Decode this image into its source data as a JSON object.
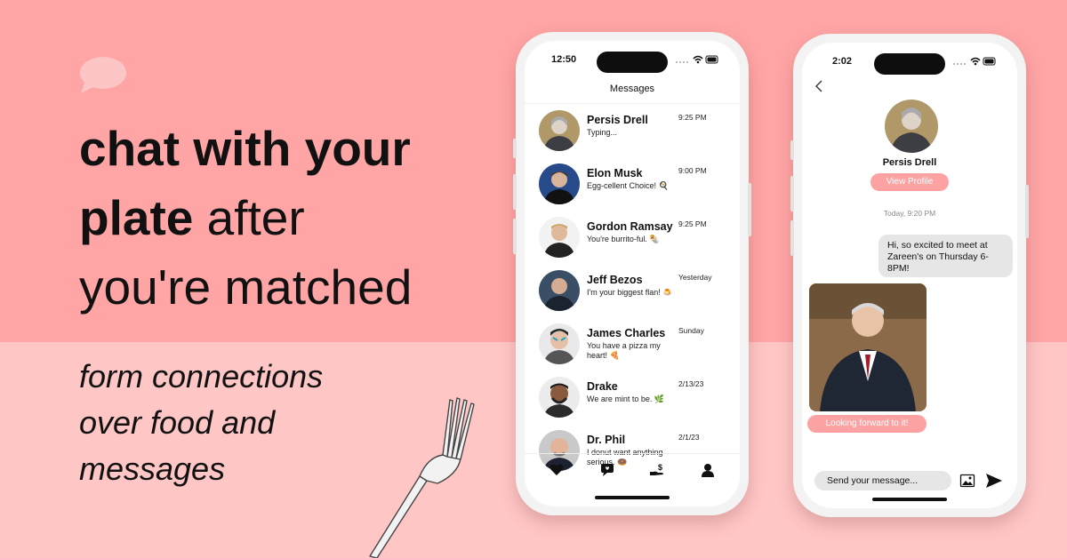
{
  "colors": {
    "accent": "#fca2a2",
    "bg_top": "#ffa5a5",
    "bg_bottom": "#ffc6c6"
  },
  "headline": {
    "line1_bold": "chat with your",
    "line2_bold": "plate",
    "line2_light": " after",
    "line3_light": "you're matched"
  },
  "subheadline": {
    "lines": [
      "form connections",
      "over food and",
      "messages"
    ]
  },
  "phone_left": {
    "time": "12:50",
    "screen_title": "Messages",
    "conversations": [
      {
        "name": "Persis Drell",
        "snippet": "Typing...",
        "timestamp": "9:25 PM"
      },
      {
        "name": "Elon Musk",
        "snippet": "Egg-cellent Choice! 🍳",
        "timestamp": "9:00 PM"
      },
      {
        "name": "Gordon Ramsay",
        "snippet": "You're burrito-ful. 🌯",
        "timestamp": "9:25 PM"
      },
      {
        "name": "Jeff Bezos",
        "snippet": "I'm your biggest flan! 🍮",
        "timestamp": "Yesterday"
      },
      {
        "name": "James Charles",
        "snippet": "You have a pizza my heart! 🍕",
        "timestamp": "Sunday"
      },
      {
        "name": "Drake",
        "snippet": "We are mint to be. 🌿",
        "timestamp": "2/13/23"
      },
      {
        "name": "Dr. Phil",
        "snippet": "I donut want anything serious. 🍩",
        "timestamp": "2/1/23"
      }
    ],
    "tab_icons": [
      "heart-icon",
      "chat-icon",
      "donate-icon",
      "profile-icon"
    ]
  },
  "phone_right": {
    "time": "2:02",
    "profile_name": "Persis Drell",
    "view_profile_label": "View Profile",
    "day_stamp": "Today, 9:20 PM",
    "incoming_message": "Hi, so excited to meet at Zareen's on Thursday 6-8PM!",
    "outgoing_message": "Looking forward to it!",
    "compose_placeholder": "Send your message..."
  }
}
